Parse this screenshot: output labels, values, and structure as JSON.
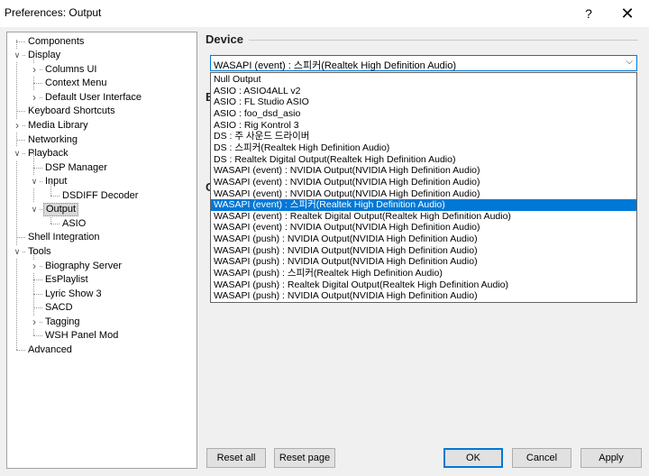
{
  "window": {
    "title": "Preferences: Output",
    "help_glyph": "?",
    "close_glyph": "✕"
  },
  "tree": {
    "items": [
      {
        "label": "Components"
      },
      {
        "label": "Display"
      },
      {
        "label": "Columns UI"
      },
      {
        "label": "Context Menu"
      },
      {
        "label": "Default User Interface"
      },
      {
        "label": "Keyboard Shortcuts"
      },
      {
        "label": "Media Library"
      },
      {
        "label": "Networking"
      },
      {
        "label": "Playback"
      },
      {
        "label": "DSP Manager"
      },
      {
        "label": "Input"
      },
      {
        "label": "DSDIFF Decoder"
      },
      {
        "label": "Output"
      },
      {
        "label": "ASIO"
      },
      {
        "label": "Shell Integration"
      },
      {
        "label": "Tools"
      },
      {
        "label": "Biography Server"
      },
      {
        "label": "EsPlaylist"
      },
      {
        "label": "Lyric Show 3"
      },
      {
        "label": "SACD"
      },
      {
        "label": "Tagging"
      },
      {
        "label": "WSH Panel Mod"
      },
      {
        "label": "Advanced"
      }
    ],
    "selected": "Output"
  },
  "device": {
    "section_title": "Device",
    "selected_value": "WASAPI (event) : 스피커(Realtek High Definition Audio)",
    "options": [
      "Null Output",
      "ASIO : ASIO4ALL v2",
      "ASIO : FL Studio ASIO",
      "ASIO : foo_dsd_asio",
      "ASIO : Rig Kontrol 3",
      "DS : 주 사운드 드라이버",
      "DS : 스피커(Realtek High Definition Audio)",
      "DS : Realtek Digital Output(Realtek High Definition Audio)",
      "WASAPI (event) : NVIDIA Output(NVIDIA High Definition Audio)",
      "WASAPI (event) : NVIDIA Output(NVIDIA High Definition Audio)",
      "WASAPI (event) : NVIDIA Output(NVIDIA High Definition Audio)",
      "WASAPI (event) : 스피커(Realtek High Definition Audio)",
      "WASAPI (event) : Realtek Digital Output(Realtek High Definition Audio)",
      "WASAPI (event) : NVIDIA Output(NVIDIA High Definition Audio)",
      "WASAPI (push) : NVIDIA Output(NVIDIA High Definition Audio)",
      "WASAPI (push) : NVIDIA Output(NVIDIA High Definition Audio)",
      "WASAPI (push) : NVIDIA Output(NVIDIA High Definition Audio)",
      "WASAPI (push) : 스피커(Realtek High Definition Audio)",
      "WASAPI (push) : Realtek Digital Output(Realtek High Definition Audio)",
      "WASAPI (push) : NVIDIA Output(NVIDIA High Definition Audio)"
    ],
    "highlighted_index": 11
  },
  "hidden_sections": {
    "peek_1": "B",
    "peek_2": "O"
  },
  "buttons": {
    "reset_all": "Reset all",
    "reset_page": "Reset page",
    "ok": "OK",
    "cancel": "Cancel",
    "apply": "Apply"
  }
}
